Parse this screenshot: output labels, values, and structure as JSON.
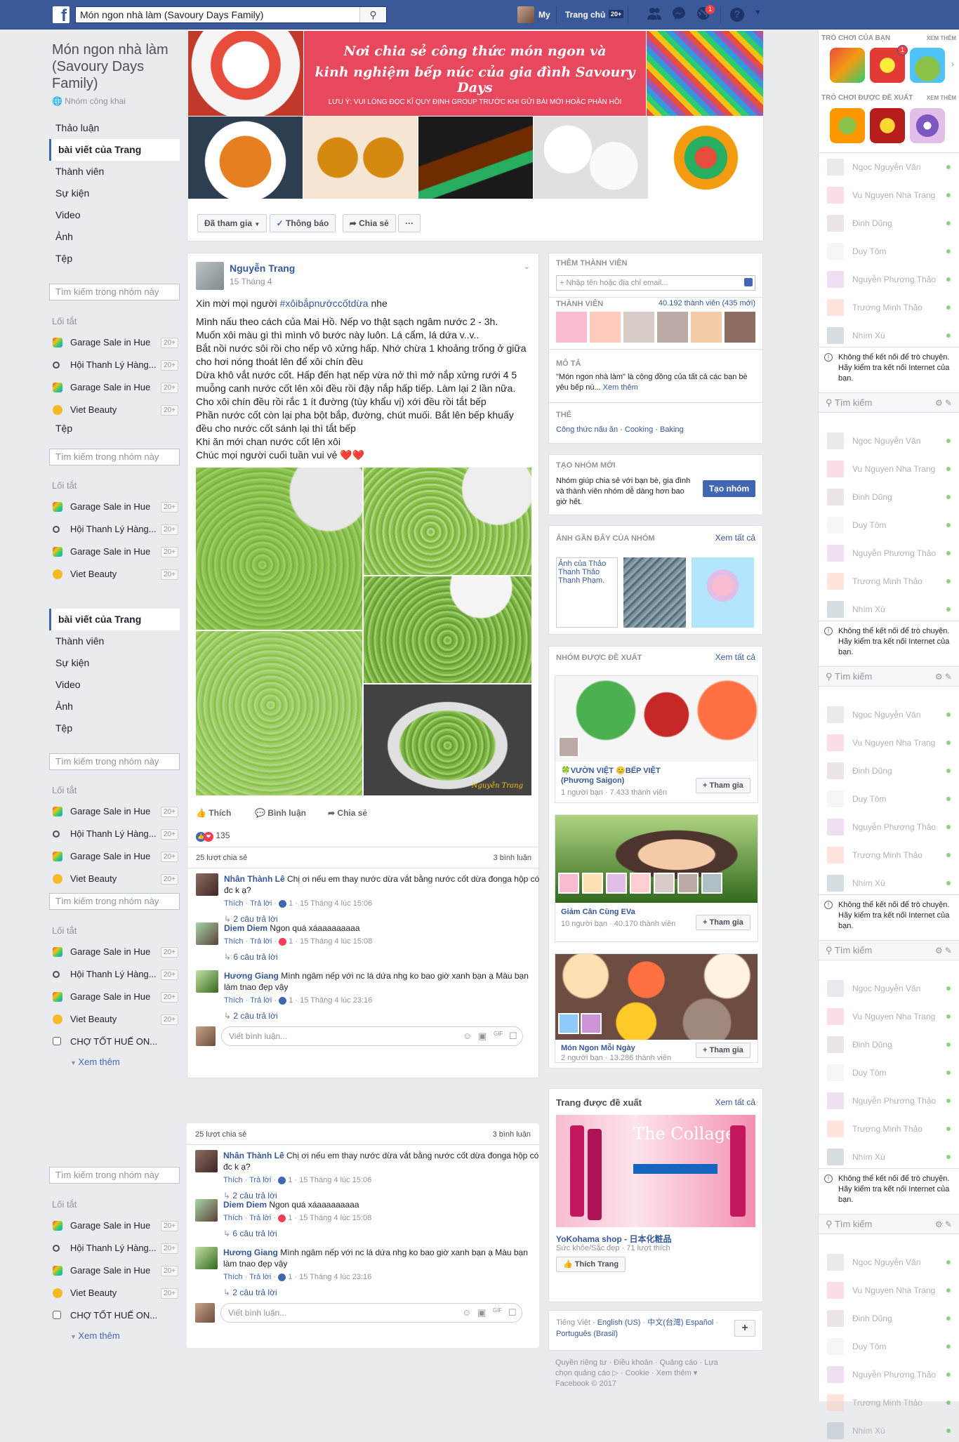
{
  "topbar": {
    "search_value": "Món ngon nhà làm (Savoury Days Family)",
    "profile_name": "My",
    "home_label": "Trang chủ",
    "home_count": "20+",
    "notif_count": "1"
  },
  "group": {
    "name": "Món ngon nhà làm (Savoury Days Family)",
    "privacy": "Nhóm công khai",
    "nav": [
      "Thảo luận",
      "bài viết của Trang",
      "Thành viên",
      "Sự kiện",
      "Video",
      "Ảnh",
      "Tệp"
    ],
    "nav_repeat": [
      "bài viết của Trang",
      "Thành viên",
      "Sự kiện",
      "Video",
      "Ảnh",
      "Tệp"
    ],
    "search_placeholder": "Tìm kiếm trong nhóm này",
    "shortcuts_label": "Lối tắt",
    "tep_label": "Tệp",
    "shortcuts": [
      {
        "label": "Garage Sale in Hue",
        "count": "20+",
        "icon": "rainbow"
      },
      {
        "label": "Hội Thanh Lý Hàng...",
        "count": "20+",
        "icon": "glasses"
      },
      {
        "label": "Garage Sale in Hue",
        "count": "20+",
        "icon": "rainbow"
      },
      {
        "label": "Viet Beauty",
        "count": "20+",
        "icon": "sun"
      }
    ],
    "extra_shortcut": "CHỢ TỐT HUẾ ON...",
    "see_more": "Xem thêm"
  },
  "cover": {
    "banner_line1": "Nơi chia sẻ công thức món ngon và",
    "banner_line2": "kinh nghiệm bếp núc của gia đình Savoury Days",
    "banner_note": "LƯU Ý: VUI LÒNG ĐỌC KĨ QUY ĐỊNH GROUP TRƯỚC KHI GỬI BÀI MỚI HOẶC PHẢN HỒI",
    "joined_btn": "Đã tham gia",
    "notify_btn": "Thông báo",
    "share_btn": "Chia sẻ",
    "more_btn": "···"
  },
  "post": {
    "author": "Nguyễn Trang",
    "date": "15 Tháng 4",
    "intro": "Xin mời mọi người",
    "hashtag": "#xôibắpnướccốtdừa",
    "intro_end": "nhe",
    "body": [
      "Mình nấu theo cách của Mai Hồ. Nếp vo thật sạch ngâm nước 2 - 3h.",
      "Muốn xôi màu gì thì mình vô bước này luôn. Lá cẩm, lá dứa v..v..",
      "Bắt nồi nước sôi rồi cho nếp vô xửng hấp. Nhớ chừa 1 khoảng trống ở giữa cho hơi nóng thoát lên để xôi chín đều",
      "Dừa khô vắt nước cốt. Hấp đến hạt nếp vừa nở thì mở nắp xửng rưới 4 5 muỗng canh nước cốt lên xôi đều rồi đậy nắp hấp tiếp. Làm lại 2 lần nữa.",
      "Cho xôi chín đều rồi rắc 1 ít đường (tùy khẩu vị) xới đều rồi tắt bếp",
      "Phần nước cốt còn lại pha bột bắp, đường, chút muối. Bắt lên bếp khuấy đều cho nước cốt sánh lại thì tắt bếp",
      "Khi ăn mới chan nước cốt lên xôi",
      "Chúc mọi người cuối tuần vui vẻ ❤️❤️"
    ],
    "watermark": "Nguyễn Trang",
    "actions": {
      "like": "Thích",
      "comment": "Bình luận",
      "share": "Chia sẻ"
    },
    "reactions": "135",
    "shares": "25 lượt chia sẻ",
    "comment_count": "3 bình luận",
    "comments": [
      {
        "name": "Nhân Thành Lê",
        "text": "Chị ơi nếu em thay nước dừa vắt bằng nước cốt dừa đonga hộp có đc k ạ?",
        "like": "Thích",
        "reply": "Trả lời",
        "react_count": "1",
        "time": "15 Tháng 4 lúc 15:06",
        "replies": "2 câu trả lời",
        "react": "like"
      },
      {
        "name": "Diem Diem",
        "text": "Ngon quá xáaaaaaaaaa",
        "like": "Thích",
        "reply": "Trả lời",
        "react_count": "1",
        "time": "15 Tháng 4 lúc 15:08",
        "replies": "6 câu trả lời",
        "react": "love"
      },
      {
        "name": "Hương Giang",
        "text": "Mình ngâm nếp với nc lá dứa nhg ko bao giờ xanh bạn ạ Màu bạn làm tnao đẹp vậy",
        "like": "Thích",
        "reply": "Trả lời",
        "react_count": "1",
        "time": "15 Tháng 4 lúc 23:16",
        "replies": "2 câu trả lời",
        "react": "like"
      }
    ],
    "write_placeholder": "Viết bình luận..."
  },
  "members": {
    "add_title": "THÊM THÀNH VIÊN",
    "add_placeholder": "+ Nhập tên hoặc địa chỉ email...",
    "members_label": "THÀNH VIÊN",
    "members_count": "40.192 thành viên (435 mới)",
    "desc_label": "MÔ TẢ",
    "desc": "\"Món ngon nhà làm\" là cộng đồng của tất cả các bạn bè yêu bếp nú...",
    "desc_more": "Xem thêm",
    "tags_label": "THẺ",
    "tags": [
      "Công thức nấu ăn",
      "Cooking",
      "Baking"
    ]
  },
  "create_group": {
    "title": "TẠO NHÓM MỚI",
    "desc": "Nhóm giúp chia sẻ với bạn bè, gia đình và thành viên nhóm dễ dàng hơn bao giờ hết.",
    "button": "Tạo nhóm"
  },
  "recent_photos": {
    "title": "ẢNH GẦN ĐÂY CỦA NHÓM",
    "see_all": "Xem tất cả",
    "broken_alt": "Ảnh của Thảo Thanh Thảo Thanh Phạm."
  },
  "suggested_groups": {
    "title": "NHÓM ĐƯỢC ĐỀ XUẤT",
    "see_all": "Xem tất cả",
    "join": "+ Tham gia",
    "items": [
      {
        "name": "🍀VƯỜN VIỆT 😊BẾP VIỆT (Phương Saigon)",
        "meta": "1 người bạn · 7.433 thành viên"
      },
      {
        "name": "Giảm Cân Cùng EVa",
        "meta": "10 người bạn · 40.170 thành viên"
      },
      {
        "name": "Món Ngon Mỗi Ngày",
        "meta": "2 người bạn · 13.286 thành viên"
      }
    ]
  },
  "suggested_page": {
    "title": "Trang được đề xuất",
    "see_all": "Xem tất cả",
    "ad_title": "The Collagen",
    "name": "YoKohama shop - 日本化粧品",
    "meta": "Sức khỏe/Sắc đẹp · 71 lượt thích",
    "like_btn": "Thích Trang"
  },
  "languages": {
    "items": [
      "Tiếng Việt",
      "English (US)",
      "中文(台灣)",
      "Español",
      "Português (Brasil)"
    ],
    "plus": "+"
  },
  "footer": {
    "links": "Quyền riêng tư · Điều khoản · Quảng cáo · Lựa chọn quảng cáo ▷ · Cookie · Xem thêm ▾",
    "copyright": "Facebook © 2017"
  },
  "chat": {
    "your_games": "TRÒ CHƠI CỦA BẠN",
    "suggested_games": "TRÒ CHƠI ĐƯỢC ĐỀ XUẤT",
    "see_more": "XEM THÊM",
    "contacts": [
      "Ngoc Nguyễn Văn",
      "Vu Nguyen Nha Trang",
      "Đinh Dũng",
      "Duy Tôm",
      "Nguyễn Phương Thảo",
      "Trương Minh Thảo",
      "Nhím Xù"
    ],
    "warning": "Không thể kết nối để trò chuyện. Hãy kiểm tra kết nối Internet của bạn.",
    "search": "Tìm kiếm"
  },
  "colors": {
    "brand": "#3b5998",
    "link": "#365899",
    "accent": "#4267b2",
    "bg": "#e9ebee",
    "banner": "#e8485e"
  }
}
